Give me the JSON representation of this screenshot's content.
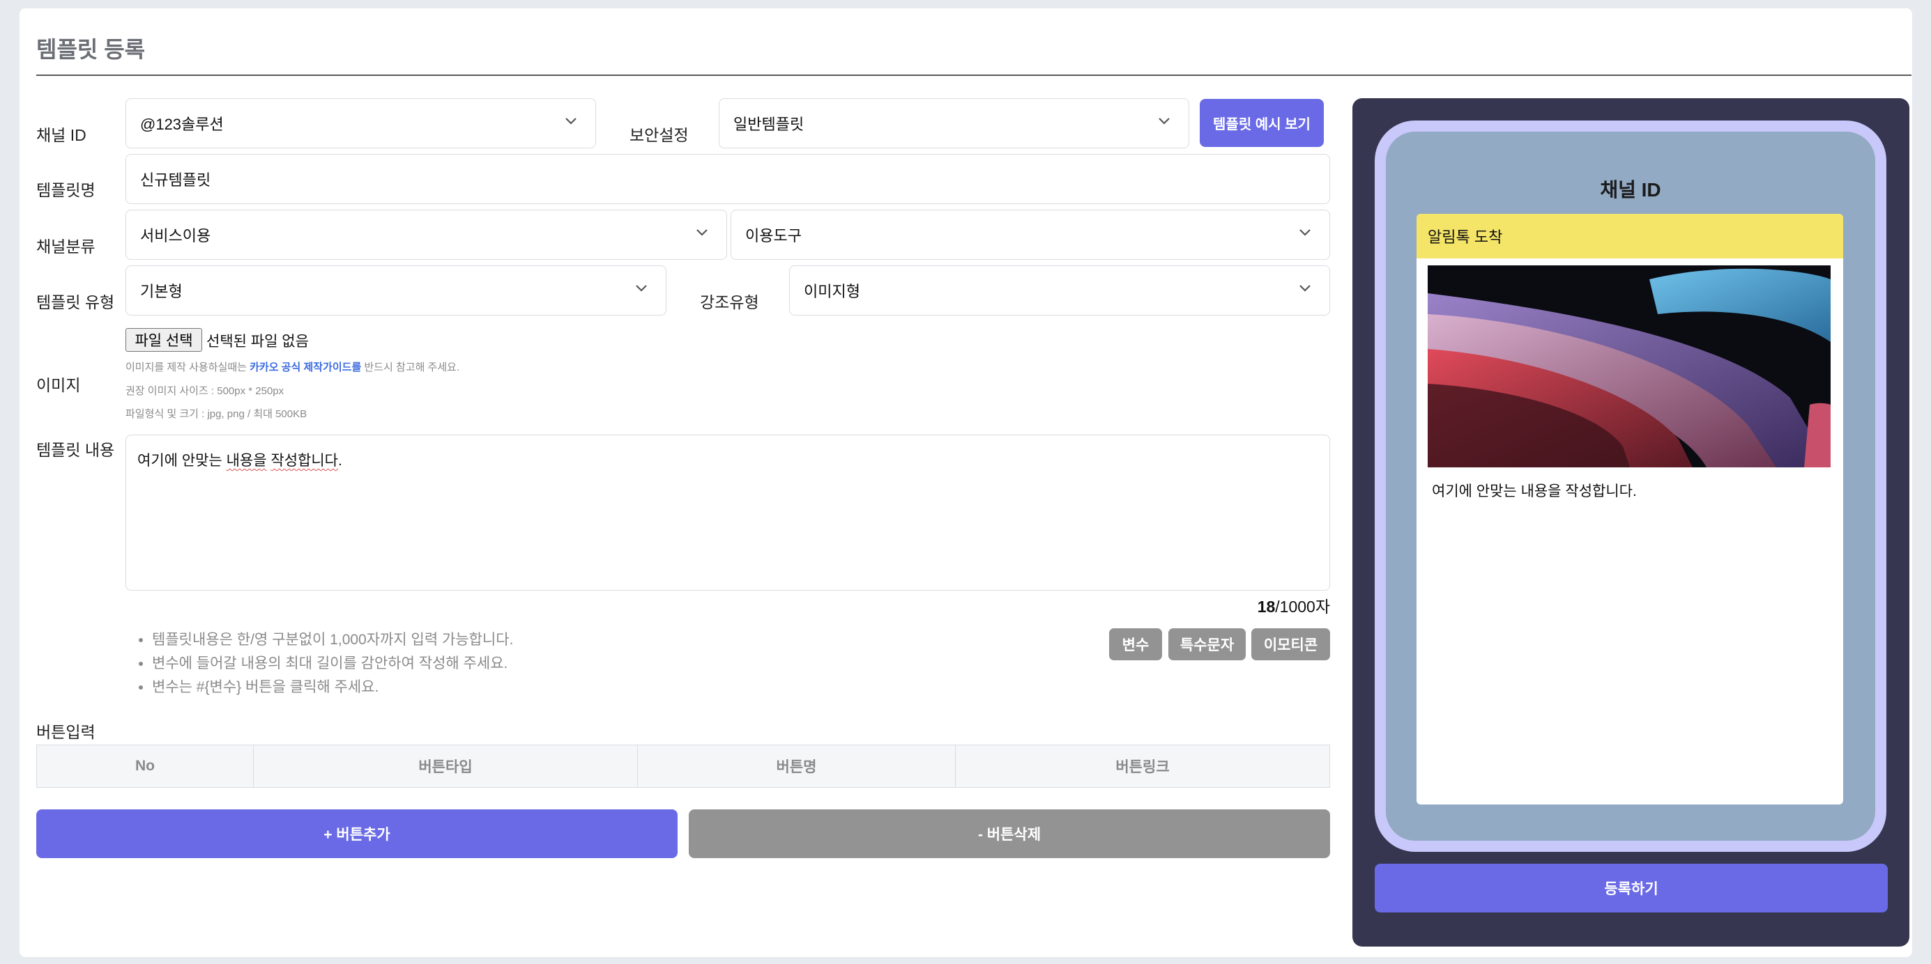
{
  "page": {
    "title": "템플릿 등록"
  },
  "form": {
    "channel_id_label": "채널 ID",
    "channel_id_value": "@123솔루션",
    "security_label": "보안설정",
    "security_value": "일반템플릿",
    "preview_button": "템플릿 예시 보기",
    "template_name_label": "템플릿명",
    "template_name_value": "신규템플릿",
    "category_label": "채널분류",
    "category_value_1": "서비스이용",
    "category_value_2": "이용도구",
    "template_type_label": "템플릿 유형",
    "template_type_value": "기본형",
    "emphasis_label": "강조유형",
    "emphasis_value": "이미지형",
    "image_label": "이미지",
    "file_button": "파일 선택",
    "file_status": "선택된 파일 없음",
    "image_hint_prefix": "이미지를 제작 사용하실때는 ",
    "image_hint_link": "카카오 공식 제작가이드를",
    "image_hint_suffix": " 반드시 참고해 주세요.",
    "image_size_hint": "권장 이미지 사이즈 : 500px * 250px",
    "image_format_hint": "파일형식 및 크기 : jpg, png / 최대 500KB",
    "content_label": "템플릿 내용",
    "content_text_a": "여기에 안맞는 ",
    "content_text_b": "내용을",
    "content_text_c": " ",
    "content_text_d": "작성합니다",
    "content_text_e": ".",
    "counter_value": "18",
    "counter_suffix": "/1000자",
    "notes": [
      "템플릿내용은 한/영 구분없이 1,000자까지 입력 가능합니다.",
      "변수에 들어갈 내용의 최대 길이를 감안하여 작성해 주세요.",
      "변수는 #{변수} 버튼을 클릭해 주세요."
    ],
    "btn_variable": "변수",
    "btn_special": "특수문자",
    "btn_emoticon": "이모티콘"
  },
  "buttons_section": {
    "label": "버튼입력",
    "columns": [
      "No",
      "버튼타입",
      "버튼명",
      "버튼링크"
    ],
    "add_label": "+ 버튼추가",
    "delete_label": "- 버튼삭제"
  },
  "preview": {
    "channel_title": "채널 ID",
    "message_header": "알림톡 도착",
    "message_body": "여기에 안맞는 내용을 작성합니다.",
    "submit_label": "등록하기"
  },
  "colors": {
    "accent": "#6a6ae6",
    "gray_button": "#939393",
    "preview_bg": "#363650",
    "phone_frame": "#c8c8fa",
    "phone_screen": "#92aac4",
    "message_header": "#f4e468"
  }
}
